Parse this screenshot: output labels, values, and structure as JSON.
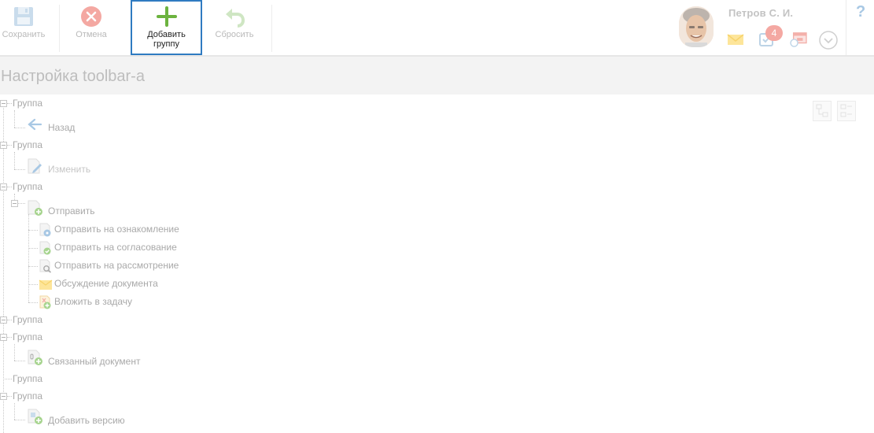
{
  "toolbar": {
    "save_label": "Сохранить",
    "cancel_label": "Отмена",
    "add_group_label": "Добавить группу",
    "reset_label": "Сбросить"
  },
  "user": {
    "name": "Петров С. И.",
    "task_badge": "4",
    "help": "?"
  },
  "page": {
    "title": "Настройка toolbar-а"
  },
  "tree": {
    "g1": "Группа",
    "back": "Назад",
    "g2": "Группа",
    "edit": "Изменить",
    "g3": "Группа",
    "send": "Отправить",
    "send_review": "Отправить на ознакомление",
    "send_approval": "Отправить на согласование",
    "send_consider": "Отправить на рассмотрение",
    "discuss": "Обсуждение документа",
    "attach_task": "Вложить в задачу",
    "g4": "Группа",
    "g5": "Группа",
    "linked_doc": "Связанный документ",
    "g6": "Группа",
    "g7": "Группа",
    "add_version": "Добавить версию"
  },
  "colors": {
    "accent": "#2f7bc1",
    "add_green": "#6cb33f",
    "cancel_red": "#f4a8a2",
    "title_bg": "#f3f3f3"
  }
}
